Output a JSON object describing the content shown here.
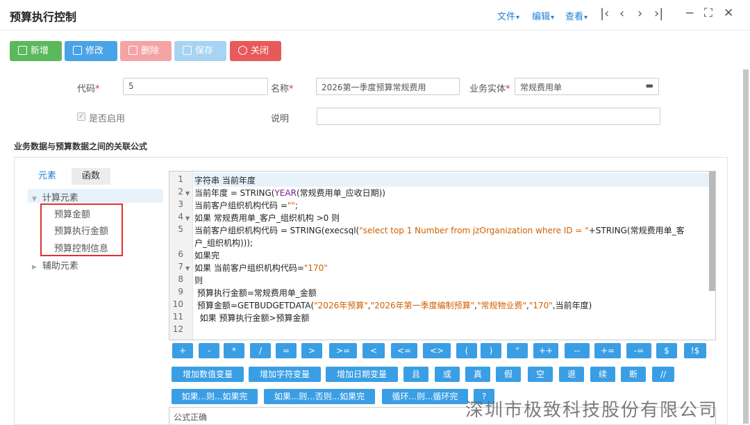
{
  "window": {
    "title": "预算执行控制",
    "menus": [
      "文件",
      "编辑",
      "查看"
    ]
  },
  "toolbar": {
    "new": "新增",
    "edit": "修改",
    "delete": "删除",
    "save": "保存",
    "close": "关闭"
  },
  "form": {
    "code_label": "代码",
    "code_value": "5",
    "name_label": "名称",
    "name_value": "2026第一季度预算常规费用",
    "entity_label": "业务实体",
    "entity_value": "常规费用单",
    "enabled_label": "是否启用",
    "desc_label": "说明",
    "desc_value": ""
  },
  "section_title": "业务数据与预算数据之间的关联公式",
  "tabs": [
    "元素",
    "函数"
  ],
  "tree": {
    "calc_group": "计算元素",
    "calc_items": [
      "预算金额",
      "预算执行金额",
      "预算控制信息"
    ],
    "aux_group": "辅助元素"
  },
  "editor_lines": [
    {
      "n": "1",
      "fold": false,
      "parts": [
        {
          "t": "字符串 当前年度",
          "c": ""
        }
      ]
    },
    {
      "n": "2",
      "fold": true,
      "parts": [
        {
          "t": "当前年度 = STRING(",
          "c": ""
        },
        {
          "t": "YEAR",
          "c": "kw"
        },
        {
          "t": "(常规费用单_应收日期))",
          "c": ""
        }
      ]
    },
    {
      "n": "3",
      "fold": false,
      "parts": [
        {
          "t": "当前客户组织机构代码 =",
          "c": ""
        },
        {
          "t": "\"\"",
          "c": "str"
        },
        {
          "t": ";",
          "c": ""
        }
      ]
    },
    {
      "n": "4",
      "fold": true,
      "parts": [
        {
          "t": "如果 常规费用单_客户_组织机构 >0 则",
          "c": ""
        }
      ]
    },
    {
      "n": "5",
      "fold": false,
      "parts": [
        {
          "t": "当前客户组织机构代码 = STRING(execsql(",
          "c": ""
        },
        {
          "t": "\"select top 1 Number from jzOrganization where ID = \"",
          "c": "str"
        },
        {
          "t": "+STRING(常规费用单_客",
          "c": ""
        }
      ]
    },
    {
      "n": "",
      "fold": false,
      "parts": [
        {
          "t": "户_组织机构)));",
          "c": ""
        }
      ]
    },
    {
      "n": "6",
      "fold": false,
      "parts": [
        {
          "t": "如果完",
          "c": ""
        }
      ]
    },
    {
      "n": "7",
      "fold": true,
      "parts": [
        {
          "t": "如果 当前客户组织机构代码=",
          "c": ""
        },
        {
          "t": "\"170\"",
          "c": "str"
        }
      ]
    },
    {
      "n": "8",
      "fold": false,
      "parts": [
        {
          "t": "则",
          "c": ""
        }
      ]
    },
    {
      "n": "9",
      "fold": false,
      "parts": [
        {
          "t": " 预算执行金额=常规费用单_金额",
          "c": ""
        }
      ]
    },
    {
      "n": "10",
      "fold": false,
      "parts": [
        {
          "t": " 预算金额=GETBUDGETDATA(",
          "c": ""
        },
        {
          "t": "\"2026年预算\"",
          "c": "str"
        },
        {
          "t": ",",
          "c": ""
        },
        {
          "t": "\"2026年第一季度编制预算\"",
          "c": "str"
        },
        {
          "t": ",",
          "c": ""
        },
        {
          "t": "\"常规物业费\"",
          "c": "str"
        },
        {
          "t": ",",
          "c": ""
        },
        {
          "t": "\"170\"",
          "c": "str"
        },
        {
          "t": ",当前年度)",
          "c": ""
        }
      ]
    },
    {
      "n": "11",
      "fold": false,
      "parts": [
        {
          "t": "  如果 预算执行金额>预算金额",
          "c": ""
        }
      ]
    },
    {
      "n": "12",
      "fold": false,
      "parts": [
        {
          "t": "",
          "c": ""
        }
      ]
    }
  ],
  "operators_row1": [
    "+",
    "-",
    "*",
    "/",
    "=",
    ">",
    ">=",
    "<",
    "<=",
    "<>",
    "(",
    ")",
    "\"",
    "++",
    "--",
    "+=",
    "-=",
    "$",
    "!$"
  ],
  "operators_row2": [
    "增加数值变量",
    "增加字符变量",
    "增加日期变量",
    "且",
    "或",
    "真",
    "假",
    "空",
    "退",
    "续",
    "断",
    "//"
  ],
  "operators_row3": [
    "如果...则...如果完",
    "如果...则...否则...如果完",
    "循环...则...循环完",
    "?"
  ],
  "status": "公式正确",
  "watermark": "深圳市极致科技股份有限公司",
  "colors": {
    "accent": "#1e7fd6",
    "op_button": "#3a9ee4",
    "required": "#e03030"
  }
}
